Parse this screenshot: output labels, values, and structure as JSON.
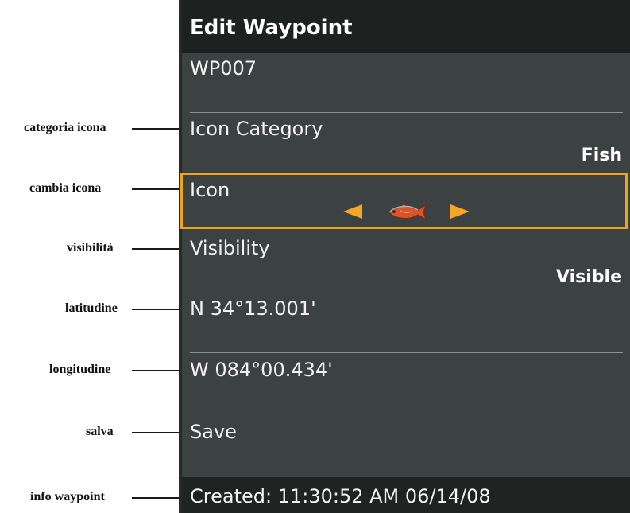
{
  "header": {
    "title": "Edit Waypoint"
  },
  "rows": {
    "name": {
      "value": "WP007"
    },
    "icon_category": {
      "label": "Icon Category",
      "value": "Fish"
    },
    "icon": {
      "label": "Icon",
      "icon_name": "fish-icon"
    },
    "visibility": {
      "label": "Visibility",
      "value": "Visible"
    },
    "latitude": {
      "value": "N 34°13.001'"
    },
    "longitude": {
      "value": "W 084°00.434'"
    },
    "save": {
      "label": "Save"
    }
  },
  "footer": {
    "info": "Created: 11:30:52 AM 06/14/08"
  },
  "callouts": {
    "icon_category": "categoria icona",
    "change_icon": "cambia icona",
    "visibility": "visibilità",
    "latitude": "latitudine",
    "longitude": "longitudine",
    "save": "salva",
    "waypoint_info": "info waypoint"
  },
  "colors": {
    "screen_bg": "#3c4241",
    "title_bg": "#1d2120",
    "highlight": "#f0a21e",
    "arrow": "#f5a623",
    "fish_body": "#d9542a"
  }
}
